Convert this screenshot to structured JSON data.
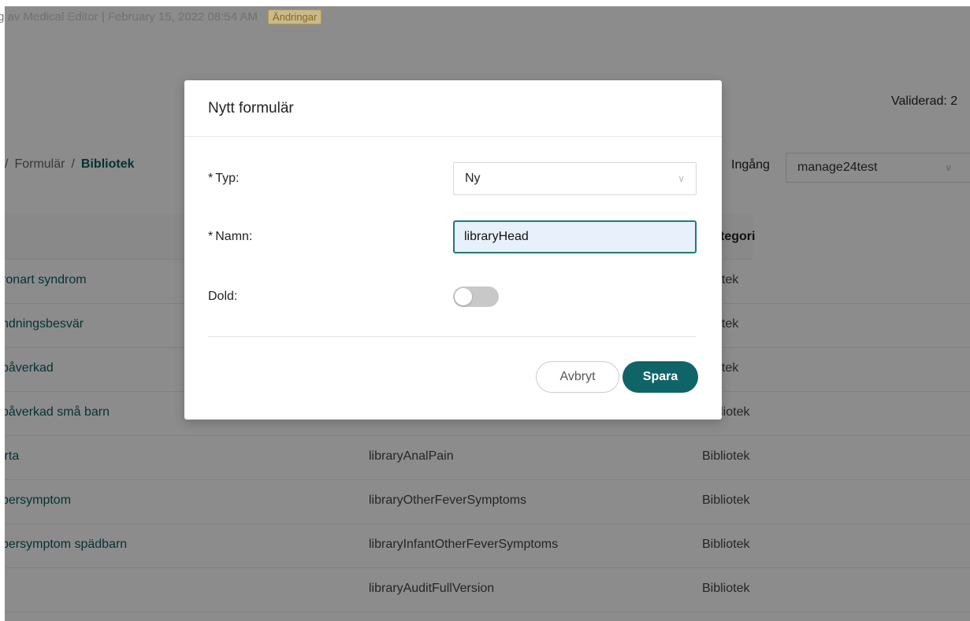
{
  "header": {
    "meta_text": "g av Medical Editor | February 15, 2022 08:54 AM",
    "changes_badge": "Ändringar",
    "validated_text": "Validerad: 2",
    "dot": "."
  },
  "breadcrumb": {
    "sep": "/",
    "items": [
      "Formulär",
      "Bibliotek"
    ]
  },
  "entry_select": {
    "label": "Ingång",
    "value": "manage24test"
  },
  "table": {
    "category_header": "tegori",
    "rows": [
      {
        "name": "ronart syndrom",
        "id": "",
        "category": "oliotek"
      },
      {
        "name": "ndningsbesvär",
        "id": "",
        "category": "oliotek"
      },
      {
        "name": "påverkad",
        "id": "",
        "category": "oliotek"
      },
      {
        "name": "påverkad små barn",
        "id": "",
        "category": "Bibliotek"
      },
      {
        "name": "irta",
        "id": "libraryAnalPain",
        "category": "Bibliotek"
      },
      {
        "name": "bersymptom",
        "id": "libraryOtherFeverSymptoms",
        "category": "Bibliotek"
      },
      {
        "name": "bersymptom spädbarn",
        "id": "libraryInfantOtherFeverSymptoms",
        "category": "Bibliotek"
      },
      {
        "name": "",
        "id": "libraryAuditFullVersion",
        "category": "Bibliotek"
      }
    ]
  },
  "modal": {
    "title": "Nytt formulär",
    "required_mark": "*",
    "type_label": "Typ:",
    "type_value": "Ny",
    "name_label": "Namn:",
    "name_value": "libraryHead",
    "hidden_label": "Dold:",
    "hidden_on": false,
    "cancel_label": "Avbryt",
    "save_label": "Spara"
  },
  "colors": {
    "accent": "#0f6468",
    "link": "#0c5b5e",
    "badge": "#c79014"
  }
}
